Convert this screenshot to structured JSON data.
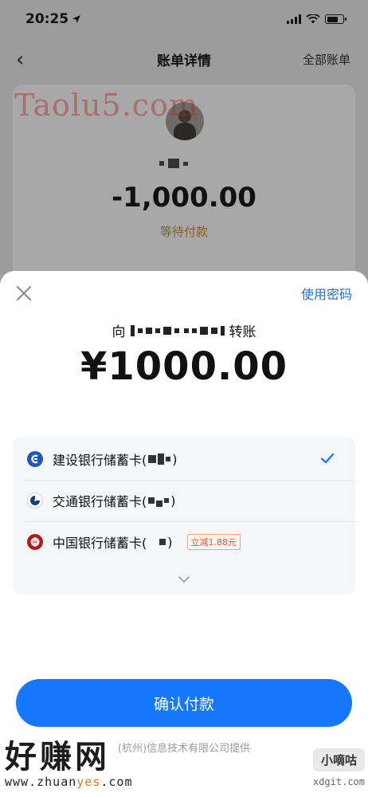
{
  "status_bar": {
    "time": "20:25"
  },
  "nav": {
    "title": "账单详情",
    "right_link": "全部账单",
    "back_glyph": "‹"
  },
  "bill": {
    "amount": "-1,000.00",
    "status": "等待付款"
  },
  "watermark_top": "Taolu5.com",
  "sheet": {
    "use_password": "使用密码",
    "payee_prefix": "向",
    "payee_suffix": "转账",
    "amount": "¥1000.00",
    "cards": [
      {
        "bank": "建设银行储蓄卡(",
        "tail": ")",
        "icon": "ccb-icon",
        "selected": true,
        "color": "#1d5ab8"
      },
      {
        "bank": "交通银行储蓄卡(",
        "tail": ")",
        "icon": "bocom-icon",
        "selected": false,
        "color": "#15407f"
      },
      {
        "bank": "中国银行储蓄卡(",
        "tail": ")",
        "icon": "boc-icon",
        "selected": false,
        "color": "#b31b1b",
        "promo": "立减1.88元"
      }
    ],
    "confirm_label": "确认付款",
    "provider_text": "(杭州)信息技术有限公司提供"
  },
  "watermark_bottom": {
    "big": "好赚网",
    "url_prefix": "www.zhuan",
    "url_accent": "yes",
    "url_suffix": ".com",
    "right_cn": "小嘀咕",
    "right_url": "xdgit.com"
  },
  "colors": {
    "accent": "#1677ff",
    "link": "#1a73d9",
    "promo": "#e05a2b"
  }
}
